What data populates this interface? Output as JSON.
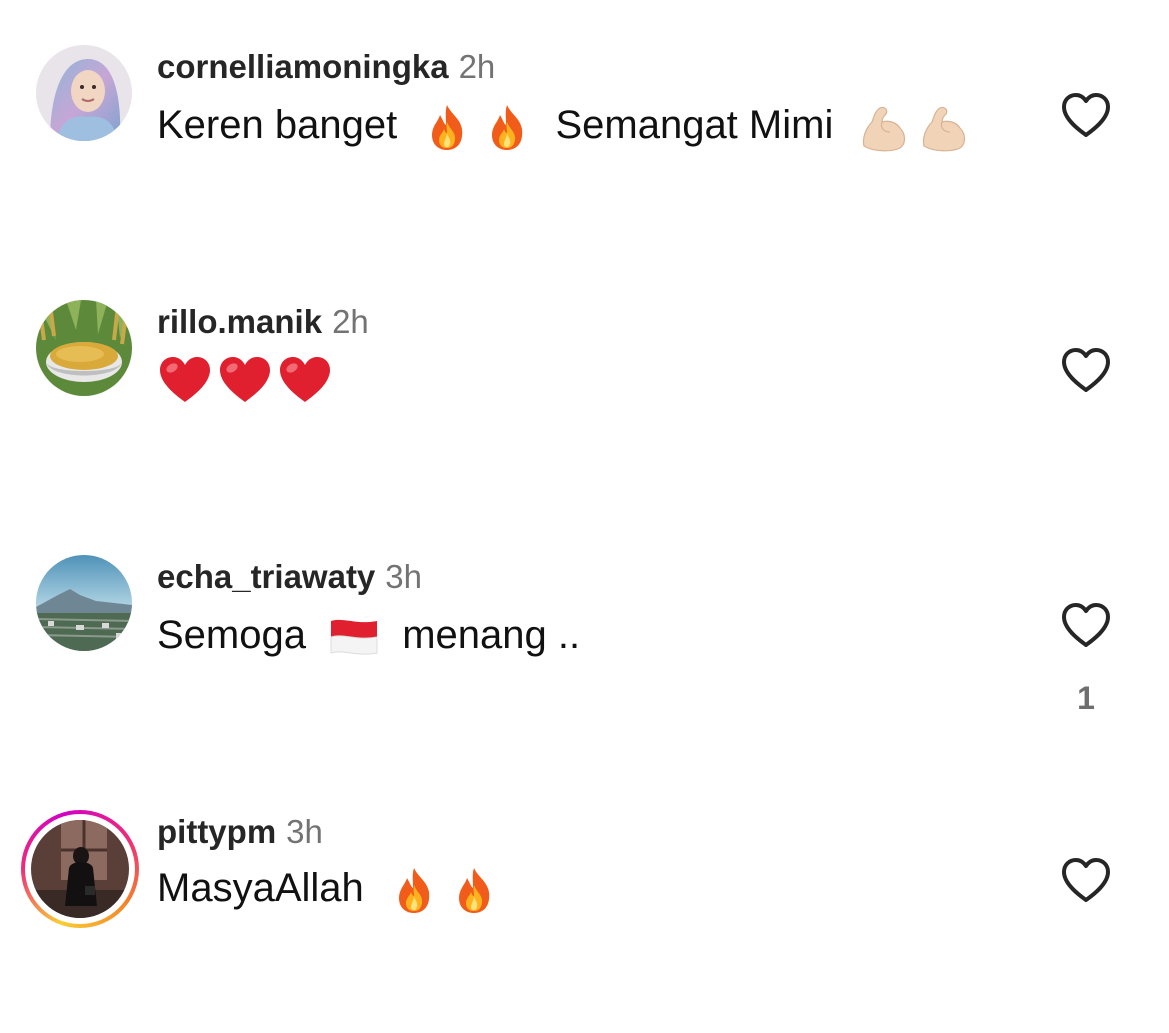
{
  "comments": [
    {
      "username": "cornelliamoningka",
      "time": "2h",
      "text_parts": [
        "Keren banget",
        "Semangat Mimi"
      ],
      "emojis": [
        "fire",
        "fire",
        "flexed-biceps",
        "flexed-biceps"
      ],
      "avatar": "person-in-hijab",
      "has_story_ring": false,
      "likes": ""
    },
    {
      "username": "rillo.manik",
      "time": "2h",
      "text_parts": [],
      "emojis": [
        "red-heart",
        "red-heart",
        "red-heart"
      ],
      "avatar": "grain-bowl",
      "has_story_ring": false,
      "likes": ""
    },
    {
      "username": "echa_triawaty",
      "time": "3h",
      "text_parts": [
        "Semoga",
        "menang .."
      ],
      "emojis": [
        "flag-indonesia"
      ],
      "avatar": "landscape-mountain",
      "has_story_ring": false,
      "likes": "1"
    },
    {
      "username": "pittypm",
      "time": "3h",
      "text_parts": [
        "MasyaAllah"
      ],
      "emojis": [
        "fire",
        "fire"
      ],
      "avatar": "person-in-dark-room",
      "has_story_ring": true,
      "likes": ""
    }
  ],
  "icons": {
    "like": "heart-outline-icon"
  },
  "colors": {
    "username": "#262626",
    "time": "#737373",
    "heart_stroke": "#262626",
    "story_ring": [
      "#f9ce34",
      "#ee2a7b",
      "#d300c5",
      "#f58529"
    ]
  }
}
